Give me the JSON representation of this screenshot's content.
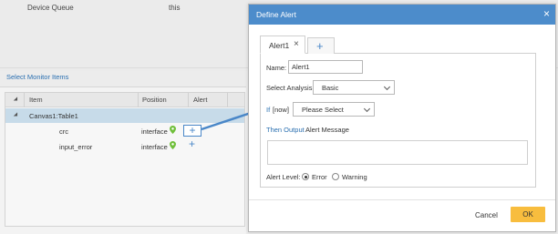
{
  "background": {
    "device_queue_label": "Device Queue",
    "device_queue_value": "this",
    "section_title": "Select Monitor Items",
    "grid": {
      "columns": [
        "Item",
        "Position",
        "Alert"
      ],
      "group_row": "Canvas1:Table1",
      "rows": [
        {
          "item": "crc",
          "position": "interface"
        },
        {
          "item": "input_error",
          "position": "interface"
        }
      ],
      "add_alert_glyph": "+"
    }
  },
  "modal": {
    "title": "Define Alert",
    "close_glyph": "×",
    "tabs": [
      {
        "label": "Alert1",
        "close_glyph": "×"
      }
    ],
    "add_tab_glyph": "+",
    "name_label": "Name:",
    "name_value": "Alert1",
    "analysis_label": "Select Analysis",
    "analysis_value": "Basic",
    "if_keyword": "If",
    "if_suffix": "[now]",
    "condition_value": "Please Select",
    "then_output_keyword": "Then Output",
    "alert_message_label": "Alert Message",
    "alert_level_label": "Alert Level:",
    "levels": [
      {
        "label": "Error",
        "selected": true
      },
      {
        "label": "Warning",
        "selected": false
      }
    ],
    "cancel_label": "Cancel",
    "ok_label": "OK"
  },
  "colors": {
    "header_blue": "#4c8ccb",
    "link_blue": "#2a6fb0",
    "ok_button": "#f8bd3e",
    "selected_row": "#c7dbe9",
    "pin_green": "#6fbf3a"
  },
  "icons": {
    "pin": "map-pin-icon",
    "add": "plus-icon",
    "close": "close-icon",
    "dropdown": "chevron-down-icon"
  }
}
